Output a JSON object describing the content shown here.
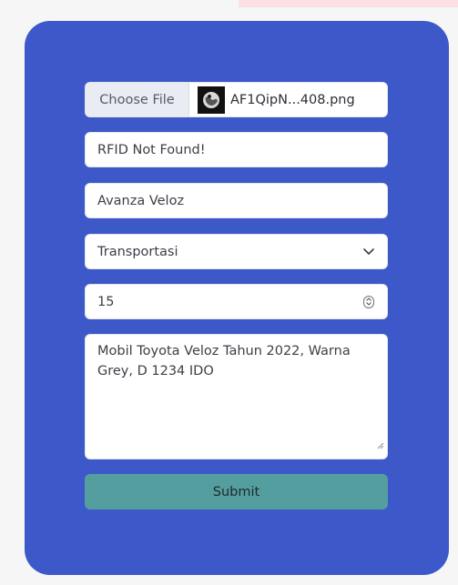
{
  "form": {
    "file": {
      "button_label": "Choose File",
      "file_name": "AF1QipN...408.png"
    },
    "rfid": {
      "value": "RFID Not Found!"
    },
    "name": {
      "value": "Avanza Veloz"
    },
    "category": {
      "selected": "Transportasi"
    },
    "quantity": {
      "value": "15"
    },
    "description": {
      "value": "Mobil Toyota Veloz Tahun 2022, Warna Grey, D 1234 IDO"
    },
    "submit_label": "Submit"
  },
  "colors": {
    "card": "#3d58c9",
    "submit": "#559ea0",
    "top_strip": "#fbe1e5"
  },
  "icons": {
    "select": "chevron-down-icon",
    "number": "stepper-icon",
    "file_thumb": "image-thumbnail-icon",
    "textarea": "resize-handle-icon"
  }
}
